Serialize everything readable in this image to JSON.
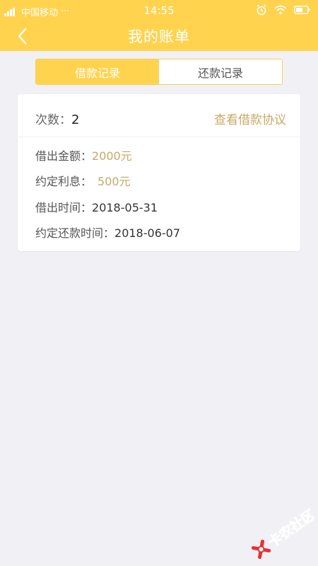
{
  "status_bar": {
    "carrier": "中国移动",
    "dots": "···",
    "time": "14:55"
  },
  "nav": {
    "title": "我的账单"
  },
  "tabs": [
    {
      "label": "借款记录",
      "active": true
    },
    {
      "label": "还款记录",
      "active": false
    }
  ],
  "record": {
    "count_label": "次数：",
    "count_value": "2",
    "agreement_link": "查看借款协议",
    "amount_label": "借出金额：",
    "amount_value": "2000元",
    "interest_label": "约定利息：",
    "interest_value": "500元",
    "loan_date_label": "借出时间：",
    "loan_date_value": "2018-05-31",
    "repay_date_label": "约定还款时间：",
    "repay_date_value": "2018-06-07"
  },
  "watermark": {
    "text": "卡农社区"
  },
  "colors": {
    "header_yellow": "#ffd34e",
    "accent_gold": "#c8a866",
    "background": "#f0f0f5"
  }
}
